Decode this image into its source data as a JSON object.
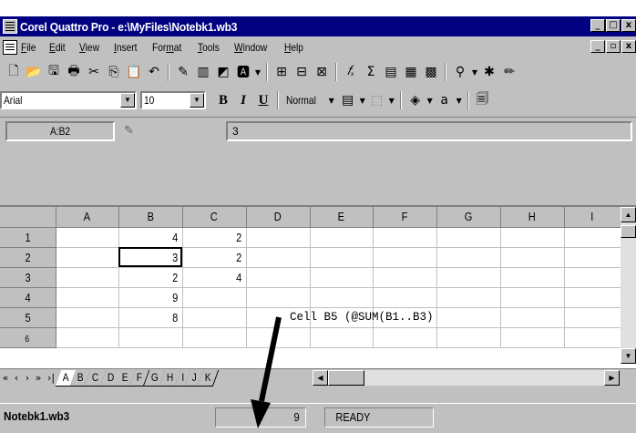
{
  "window": {
    "title": "Corel Quattro Pro - e:\\MyFiles\\Notebk1.wb3",
    "ctrl_min": "_",
    "ctrl_max": "□",
    "ctrl_close": "x",
    "doc_ctrl_min": "_",
    "doc_ctrl_restore": "▫",
    "doc_ctrl_close": "x"
  },
  "menu": [
    "File",
    "Edit",
    "View",
    "Insert",
    "Format",
    "Tools",
    "Window",
    "Help"
  ],
  "menu_access": [
    "F",
    "E",
    "V",
    "I",
    "m",
    "T",
    "W",
    "H"
  ],
  "format_bar": {
    "font": "Arial",
    "size": "10",
    "bold": "B",
    "italic": "I",
    "underline": "U",
    "style": "Normal"
  },
  "input_line": {
    "cell_ref": "A:B2",
    "value": "3"
  },
  "grid": {
    "columns": [
      "A",
      "B",
      "C",
      "D",
      "E",
      "F",
      "G",
      "H",
      "I"
    ],
    "rows": [
      {
        "num": "1",
        "A": "",
        "B": "4",
        "C": "2"
      },
      {
        "num": "2",
        "A": "",
        "B": "3",
        "C": "2"
      },
      {
        "num": "3",
        "A": "",
        "B": "2",
        "C": "4"
      },
      {
        "num": "4",
        "A": "",
        "B": "9",
        "C": ""
      },
      {
        "num": "5",
        "A": "",
        "B": "8",
        "C": ""
      },
      {
        "num": "6",
        "A": "",
        "B": "",
        "C": ""
      }
    ],
    "active_cell": "B2"
  },
  "annotation": "Cell B5 (@SUM(B1..B3)",
  "sheet_tabs": [
    "A",
    "B",
    "C",
    "D",
    "E",
    "F",
    "G",
    "H",
    "I",
    "J",
    "K"
  ],
  "tab_nav": [
    "«",
    "‹",
    "›",
    "»",
    "›|"
  ],
  "status": {
    "file": "Notebk1.wb3",
    "sum": "9",
    "mode": "READY"
  },
  "colors": {
    "titlebar": "#000080",
    "face": "#c0c0c0",
    "arrow": "#000000"
  }
}
